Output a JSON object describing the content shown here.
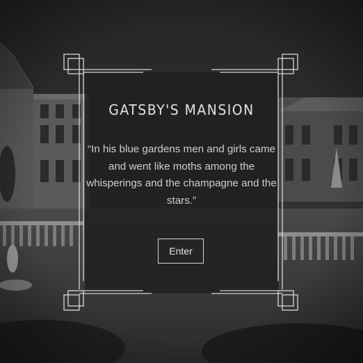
{
  "hero": {
    "title": "GATSBY'S MANSION",
    "quote": "“In his blue gardens men and girls came and went like moths among the whisperings and the champagne and the stars.”",
    "enter_label": "Enter"
  },
  "colors": {
    "overlay": "#202020",
    "frame": "#d8d8d8",
    "text": "#e2e2e2"
  }
}
